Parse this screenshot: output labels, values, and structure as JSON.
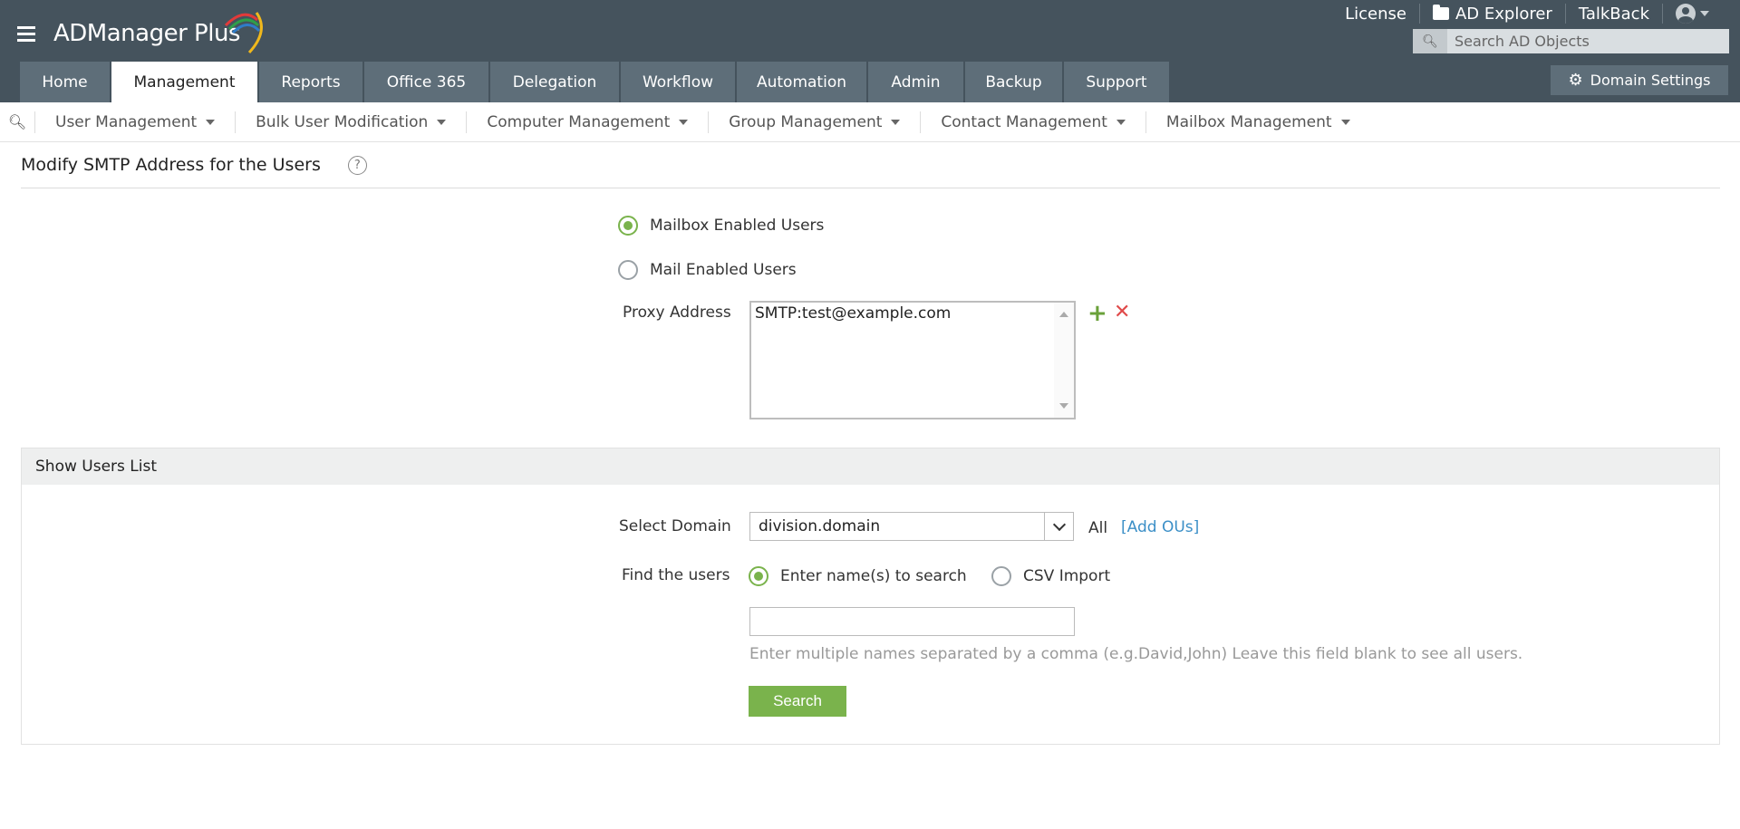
{
  "app": {
    "name_main": "ADManager",
    "name_plus": " Plus",
    "colors": {
      "header": "#45535d",
      "tab": "#5e6e79",
      "accent": "#7ab34c",
      "link": "#3b8fc7",
      "delete": "#e04a4a"
    }
  },
  "top_links": {
    "license": "License",
    "ad_explorer": "AD Explorer",
    "talkback": "TalkBack"
  },
  "search": {
    "placeholder": "Search AD Objects",
    "icon": "search-icon"
  },
  "tabs": [
    "Home",
    "Management",
    "Reports",
    "Office 365",
    "Delegation",
    "Workflow",
    "Automation",
    "Admin",
    "Backup",
    "Support"
  ],
  "active_tab": "Management",
  "domain_settings": "Domain Settings",
  "subnav": [
    "User Management",
    "Bulk User Modification",
    "Computer Management",
    "Group Management",
    "Contact Management",
    "Mailbox Management"
  ],
  "page": {
    "title": "Modify SMTP Address for the Users",
    "help": "?"
  },
  "form": {
    "mailbox_enabled": "Mailbox Enabled Users",
    "mail_enabled": "Mail Enabled Users",
    "selected_user_type": "Mailbox Enabled Users",
    "proxy_label": "Proxy Address",
    "proxy_value": "SMTP:test@example.com"
  },
  "users_panel": {
    "header": "Show Users List",
    "domain_label": "Select Domain",
    "domain_value": "division.domain",
    "all_text": "All",
    "add_ous": "[Add OUs]",
    "find_label": "Find the users",
    "opt_names": "Enter name(s) to search",
    "opt_csv": "CSV Import",
    "selected_find": "Enter name(s) to search",
    "names_value": "",
    "hint": "Enter multiple names separated by a comma (e.g.David,John) Leave this field blank to see all users.",
    "search_button": "Search"
  }
}
